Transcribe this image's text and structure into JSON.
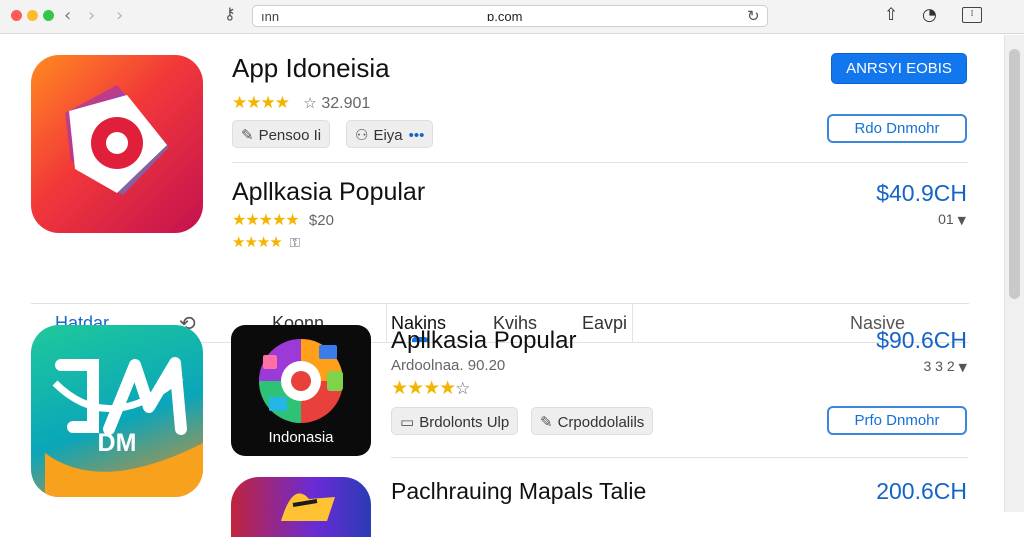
{
  "browser": {
    "url_left": "ınn",
    "url_right": "ɒ.com"
  },
  "header": {
    "app_title": "App Idoneisia",
    "rating_value": "32.901",
    "chip_1": "Pensoo Ii",
    "chip_2": "Eiya",
    "primary_button": "ANRSYI EOBIS",
    "outline_button": "Rdo Dnmohr"
  },
  "featured": {
    "title": "Apllkasia Popular",
    "rating_count": "$20",
    "price": "$40.9CH",
    "sub_price": "01"
  },
  "tabs": [
    "Hatdar",
    "Koonn",
    "Nakins",
    "Kvihs",
    "Eavpi",
    "Nasive"
  ],
  "list": [
    {
      "icon_text": "DM",
      "thumb_text": "Indonasia",
      "title": "Apllkasia Popular",
      "subtitle": "Ardoolnaa. 90.20",
      "price": "$90.6CH",
      "sub_price": "3 3 2",
      "chip_1": "Brdolonts Ulp",
      "chip_2": "Crpoddolalils",
      "button": "Prfo Dnmohr"
    },
    {
      "title": "Paclhrauing Mapals Talie",
      "price": "200.6CH"
    }
  ],
  "colors": {
    "accent": "#1277ee",
    "price": "#1464c8",
    "star": "#f5b400"
  }
}
